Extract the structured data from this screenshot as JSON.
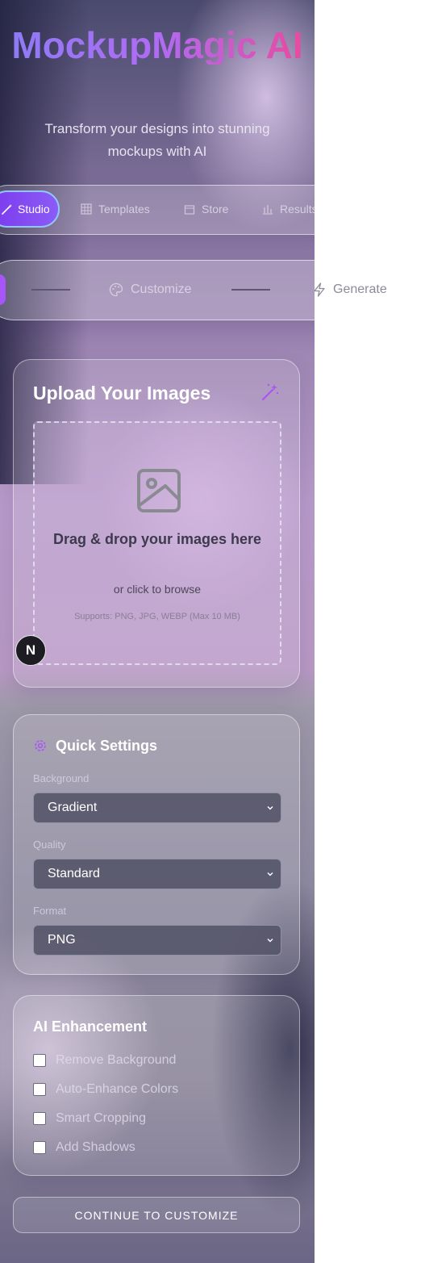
{
  "header": {
    "title": "MockupMagic AI",
    "subtitle": "Transform your designs into stunning mockups with AI"
  },
  "nav": {
    "tabs": [
      {
        "label": "Studio",
        "icon": "wand-icon",
        "active": true
      },
      {
        "label": "Templates",
        "icon": "grid-icon"
      },
      {
        "label": "Store",
        "icon": "store-icon"
      },
      {
        "label": "Results",
        "icon": "bar-chart-icon"
      }
    ]
  },
  "steps": [
    {
      "label": "",
      "active": true
    },
    {
      "label": "Customize",
      "icon": "palette-icon"
    },
    {
      "label": "Generate",
      "icon": "zap-icon"
    }
  ],
  "upload": {
    "title": "Upload Your Images",
    "drop_heading": "Drag & drop your images here",
    "drop_sub": "or click to browse",
    "formats": "Supports: PNG, JPG, WEBP (Max 10 MB)"
  },
  "dev_badge": "N",
  "settings": {
    "title": "Quick Settings",
    "background_label": "Background",
    "background_value": "Gradient",
    "quality_label": "Quality",
    "quality_value": "Standard",
    "format_label": "Format",
    "format_value": "PNG"
  },
  "ai": {
    "title": "AI Enhancement",
    "options": [
      {
        "label": "Remove Background",
        "checked": false
      },
      {
        "label": "Auto-Enhance Colors",
        "checked": false
      },
      {
        "label": "Smart Cropping",
        "checked": false
      },
      {
        "label": "Add Shadows",
        "checked": false
      }
    ]
  },
  "continue_label": "CONTINUE TO CUSTOMIZE",
  "colors": {
    "accent_purple": "#8b5cf6",
    "accent_pink": "#ec4899",
    "step_active": "#a855f7"
  }
}
